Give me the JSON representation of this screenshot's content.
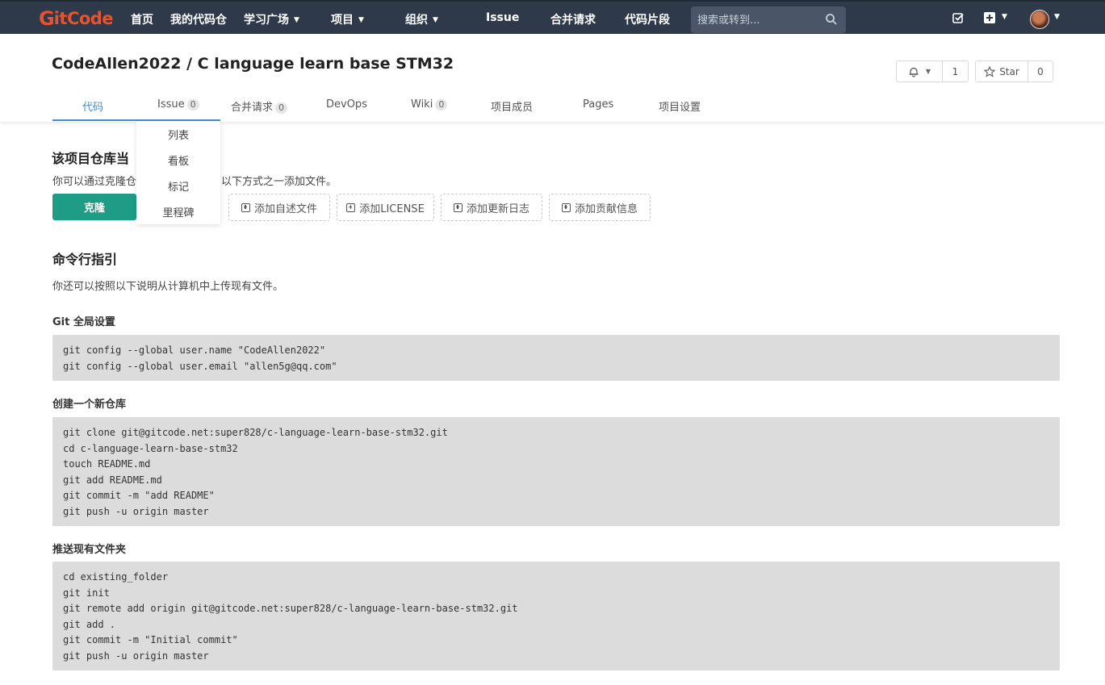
{
  "topnav": {
    "logo_prefix": "G",
    "logo_rest": "itCode",
    "items": [
      {
        "label": "首页"
      },
      {
        "label": "我的代码仓"
      },
      {
        "label": "学习广场"
      },
      {
        "label": "项目"
      },
      {
        "label": "组织"
      },
      {
        "label": "Issue"
      },
      {
        "label": "合并请求"
      },
      {
        "label": "代码片段"
      }
    ],
    "search_placeholder": "搜索或转到..."
  },
  "repo": {
    "title": "CodeAllen2022 / C language learn base STM32",
    "watch_count": "1",
    "star_label": "Star",
    "star_count": "0"
  },
  "tabs": [
    {
      "label": "代码"
    },
    {
      "label": "Issue",
      "count": "0"
    },
    {
      "label": "合并请求",
      "count": "0"
    },
    {
      "label": "DevOps"
    },
    {
      "label": "Wiki",
      "count": "0"
    },
    {
      "label": "项目成员"
    },
    {
      "label": "Pages"
    },
    {
      "label": "项目设置"
    }
  ],
  "issue_dropdown": [
    "列表",
    "看板",
    "标记",
    "里程碑"
  ],
  "empty_repo": {
    "heading": "该项目仓库当",
    "desc_left": "你可以通过克隆仓",
    "desc_right": "以下方式之一添加文件。",
    "clone_label": "克隆",
    "buttons": [
      "添加自述文件",
      "添加LICENSE",
      "添加更新日志",
      "添加贡献信息"
    ]
  },
  "cli": {
    "heading": "命令行指引",
    "desc": "你还可以按照以下说明从计算机中上传现有文件。",
    "sections": [
      {
        "title": "Git 全局设置",
        "lines": [
          "git config --global user.name \"CodeAllen2022\"",
          "git config --global user.email \"allen5g@qq.com\""
        ]
      },
      {
        "title": "创建一个新仓库",
        "lines": [
          "git clone git@gitcode.net:super828/c-language-learn-base-stm32.git",
          "cd c-language-learn-base-stm32",
          "touch README.md",
          "git add README.md",
          "git commit -m \"add README\"",
          "git push -u origin master"
        ]
      },
      {
        "title": "推送现有文件夹",
        "lines": [
          "cd existing_folder",
          "git init",
          "git remote add origin git@gitcode.net:super828/c-language-learn-base-stm32.git",
          "git add .",
          "git commit -m \"Initial commit\"",
          "git push -u origin master"
        ]
      }
    ]
  },
  "colors": {
    "topbar": "#2e3a4a",
    "brand": "#e8522e",
    "accent": "#3d8fd6",
    "clone_button": "#1e9c86",
    "code_bg": "#dcdcdc"
  }
}
